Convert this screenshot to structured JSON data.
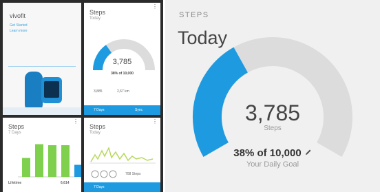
{
  "colors": {
    "accent": "#1e9be0",
    "gauge_track": "#dcdcdc",
    "bar_green": "#7fd14d",
    "panel_bg": "#f0f0f0"
  },
  "left_tiles": {
    "vivofit": {
      "title": "vivofit",
      "link1": "Get Started",
      "link2": "Learn more"
    },
    "steps_small": {
      "title": "Steps",
      "subtitle": "Today",
      "value": "3,785",
      "unit": "Steps",
      "goal": "38% of 10,000",
      "stat1": "3,885",
      "stat2": "2,67 km",
      "footer_left": "7 Days",
      "footer_right": "Sync"
    },
    "weekly": {
      "title": "Steps",
      "subtitle": "7 Days",
      "bar_levels": [
        0.55,
        0.95,
        0.92,
        0.92,
        0.35
      ],
      "left_value": "Lifetime",
      "right_value": "6,614"
    },
    "steps_chart": {
      "title": "Steps",
      "subtitle": "Today",
      "stat": "708 Steps",
      "footer": "7 Days"
    }
  },
  "main": {
    "section_label": "STEPS",
    "title": "Today",
    "steps_value": "3,785",
    "steps_unit": "Steps",
    "goal_text": "38% of 10,000",
    "goal_caption": "Your Daily Goal",
    "progress": 0.3785,
    "edit_icon": "pencil-icon"
  }
}
